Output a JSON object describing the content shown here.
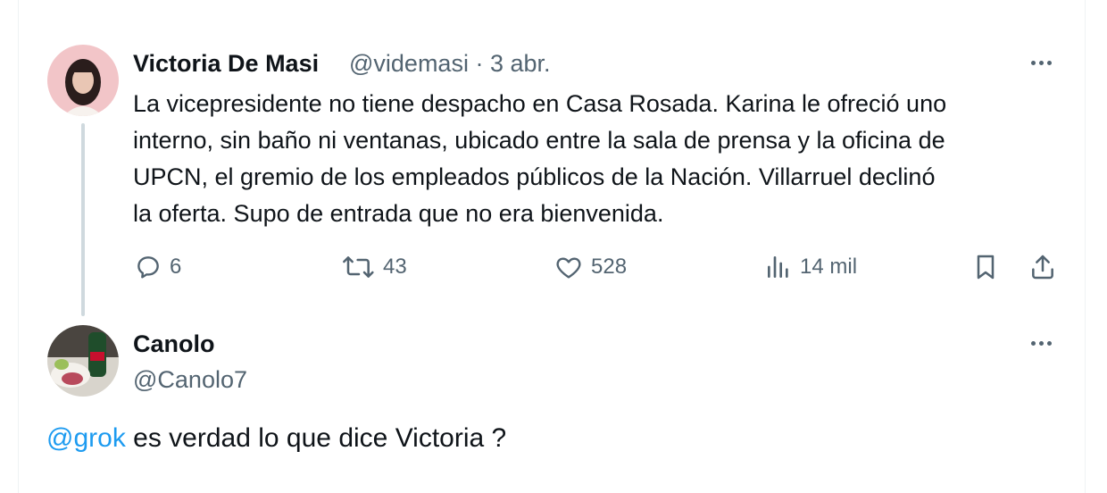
{
  "original_tweet": {
    "author_name": "Victoria De Masi",
    "handle_and_date": "@videmasi · 3 abr.",
    "text_lines": [
      "La vicepresidente no tiene despacho en Casa Rosada. Karina le ofreció uno",
      "interno, sin baño ni ventanas, ubicado entre la sala de prensa y la oficina de",
      "UPCN, el gremio de los empleados públicos de la Nación. Villarruel declinó",
      "la oferta. Supo de entrada que no era bienvenida."
    ],
    "actions": {
      "replies": "6",
      "reposts": "43",
      "likes": "528",
      "views": "14 mil"
    }
  },
  "reply_tweet": {
    "author_name": "Canolo",
    "handle": "@Canolo7",
    "mention": "@grok",
    "text": " es verdad lo que dice Victoria ?"
  },
  "icons": {
    "reply": "reply-icon",
    "repost": "repost-icon",
    "like": "heart-icon",
    "views": "views-chart-icon",
    "bookmark": "bookmark-icon",
    "share": "share-icon",
    "more": "more-icon"
  },
  "colors": {
    "link": "#1d9bf0",
    "secondary_text": "#536471",
    "thread_line": "#cfd9de"
  }
}
